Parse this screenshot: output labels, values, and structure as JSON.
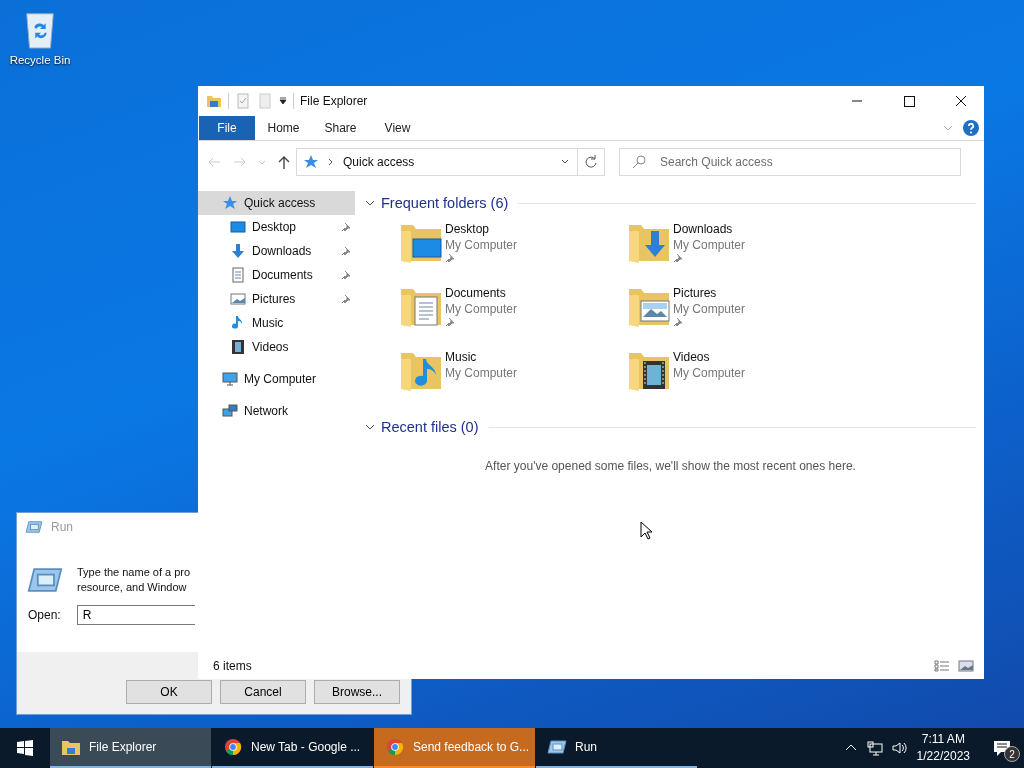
{
  "desktop_icons": [
    {
      "label": "Recycle Bin"
    }
  ],
  "run_dialog": {
    "title": "Run",
    "prompt_lines": [
      "Type the name of a pro",
      "resource, and Window"
    ],
    "open_label": "Open:",
    "value": "R",
    "buttons": [
      {
        "label": "OK"
      },
      {
        "label": "Cancel"
      },
      {
        "label": "Browse..."
      }
    ]
  },
  "explorer": {
    "title": "File Explorer",
    "ribbon_tabs": [
      {
        "label": "File",
        "kind": "file"
      },
      {
        "label": "Home",
        "kind": "tab"
      },
      {
        "label": "Share",
        "kind": "tab"
      },
      {
        "label": "View",
        "kind": "tab"
      }
    ],
    "address": "Quick access",
    "search": {
      "placeholder": "Search Quick access"
    },
    "nav": [
      {
        "label": "Quick access",
        "kind": "star",
        "selected": true,
        "children": [
          {
            "label": "Desktop",
            "kind": "desktop",
            "pinned": true,
            "selected": false
          },
          {
            "label": "Downloads",
            "kind": "downloads",
            "pinned": true,
            "selected": false
          },
          {
            "label": "Documents",
            "kind": "documents",
            "pinned": true,
            "selected": false
          },
          {
            "label": "Pictures",
            "kind": "pictures",
            "pinned": true,
            "selected": false
          },
          {
            "label": "Music",
            "kind": "music",
            "pinned": false,
            "selected": false
          },
          {
            "label": "Videos",
            "kind": "videos",
            "pinned": false,
            "selected": false
          }
        ]
      },
      {
        "label": "My Computer",
        "kind": "computer",
        "selected": false
      },
      {
        "label": "Network",
        "kind": "network",
        "selected": false
      }
    ],
    "frequent": {
      "title": "Frequent folders (6)",
      "expanded": true,
      "folders": [
        {
          "name": "Desktop",
          "location": "My Computer",
          "kind": "desktop",
          "pinned": true
        },
        {
          "name": "Downloads",
          "location": "My Computer",
          "kind": "downloads",
          "pinned": true
        },
        {
          "name": "Documents",
          "location": "My Computer",
          "kind": "documents",
          "pinned": true
        },
        {
          "name": "Pictures",
          "location": "My Computer",
          "kind": "pictures",
          "pinned": true
        },
        {
          "name": "Music",
          "location": "My Computer",
          "kind": "music",
          "pinned": false
        },
        {
          "name": "Videos",
          "location": "My Computer",
          "kind": "videos",
          "pinned": false
        }
      ]
    },
    "recent": {
      "title": "Recent files (0)",
      "expanded": true,
      "message": "After you've opened some files, we'll show the most recent ones here."
    },
    "status": "6 items"
  },
  "taskbar": {
    "items": [
      {
        "label": "File Explorer",
        "kind": "explorer",
        "active": true,
        "attention": false
      },
      {
        "label": "New Tab - Google ...",
        "kind": "chrome",
        "active": false,
        "attention": false
      },
      {
        "label": "Send feedback to G...",
        "kind": "chrome",
        "active": false,
        "attention": true
      },
      {
        "label": "Run",
        "kind": "run",
        "active": false,
        "attention": false
      }
    ],
    "time": "7:11 AM",
    "date": "1/22/2023",
    "notifications": "2"
  }
}
